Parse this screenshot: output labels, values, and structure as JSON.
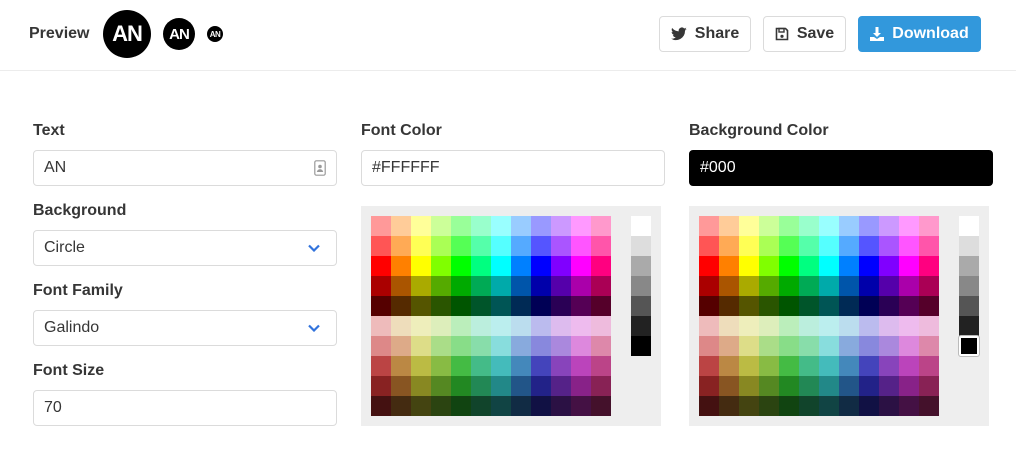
{
  "header": {
    "preview_label": "Preview",
    "avatar_text": "AN",
    "buttons": {
      "share": "Share",
      "save": "Save",
      "download": "Download"
    }
  },
  "form": {
    "text": {
      "label": "Text",
      "value": "AN"
    },
    "background": {
      "label": "Background",
      "value": "Circle"
    },
    "font_family": {
      "label": "Font Family",
      "value": "Galindo"
    },
    "font_size": {
      "label": "Font Size",
      "value": "70"
    },
    "font_color": {
      "label": "Font Color",
      "value": "#FFFFFF"
    },
    "background_color": {
      "label": "Background Color",
      "value": "#000"
    }
  },
  "palette": {
    "colors": [
      [
        "#ff9999",
        "#ffcc99",
        "#ffff99",
        "#ccff99",
        "#99ff99",
        "#99ffcc",
        "#99ffff",
        "#99ccff",
        "#9999ff",
        "#cc99ff",
        "#ff99ff",
        "#ff99cc"
      ],
      [
        "#ff5555",
        "#ffaa55",
        "#ffff55",
        "#aaff55",
        "#55ff55",
        "#55ffaa",
        "#55ffff",
        "#55aaff",
        "#5555ff",
        "#aa55ff",
        "#ff55ff",
        "#ff55aa"
      ],
      [
        "#ff0000",
        "#ff8000",
        "#ffff00",
        "#80ff00",
        "#00ff00",
        "#00ff80",
        "#00ffff",
        "#0080ff",
        "#0000ff",
        "#8000ff",
        "#ff00ff",
        "#ff0080"
      ],
      [
        "#aa0000",
        "#aa5500",
        "#aaaa00",
        "#55aa00",
        "#00aa00",
        "#00aa55",
        "#00aaaa",
        "#0055aa",
        "#0000aa",
        "#5500aa",
        "#aa00aa",
        "#aa0055"
      ],
      [
        "#550000",
        "#552a00",
        "#555500",
        "#2a5500",
        "#005500",
        "#00552a",
        "#005555",
        "#002a55",
        "#000055",
        "#2a0055",
        "#550055",
        "#55002a"
      ],
      [
        "#eebbbb",
        "#eeddbb",
        "#eeeebb",
        "#ddeebb",
        "#bbeebb",
        "#bbeedd",
        "#bbeeee",
        "#bbddee",
        "#bbbbee",
        "#ddbbee",
        "#eebbee",
        "#eebbdd"
      ],
      [
        "#dd8888",
        "#ddaa88",
        "#dddd88",
        "#aadd88",
        "#88dd88",
        "#88ddaa",
        "#88dddd",
        "#88aadd",
        "#8888dd",
        "#aa88dd",
        "#dd88dd",
        "#dd88aa"
      ],
      [
        "#bb4444",
        "#bb8844",
        "#bbbb44",
        "#88bb44",
        "#44bb44",
        "#44bb88",
        "#44bbbb",
        "#4488bb",
        "#4444bb",
        "#8844bb",
        "#bb44bb",
        "#bb4488"
      ],
      [
        "#882222",
        "#885522",
        "#888822",
        "#558822",
        "#228822",
        "#228855",
        "#228888",
        "#225588",
        "#222288",
        "#552288",
        "#882288",
        "#882255"
      ],
      [
        "#441111",
        "#442b11",
        "#444411",
        "#2b4411",
        "#114411",
        "#11442b",
        "#114444",
        "#112b44",
        "#111144",
        "#2b1144",
        "#441144",
        "#44112b"
      ]
    ],
    "grays": [
      "#ffffff",
      "#dddddd",
      "#aaaaaa",
      "#888888",
      "#555555",
      "#222222",
      "#000000"
    ],
    "font_color_selected_gray": "#ffffff",
    "background_color_selected_gray": "#000000"
  },
  "icons": {
    "share": "twitter-icon",
    "save": "floppy-disk-icon",
    "download": "download-icon",
    "text_field": "contact-card-icon",
    "select": "chevron-down-icon"
  },
  "colors": {
    "accent": "#3298dc",
    "chevron": "#3273dc"
  }
}
